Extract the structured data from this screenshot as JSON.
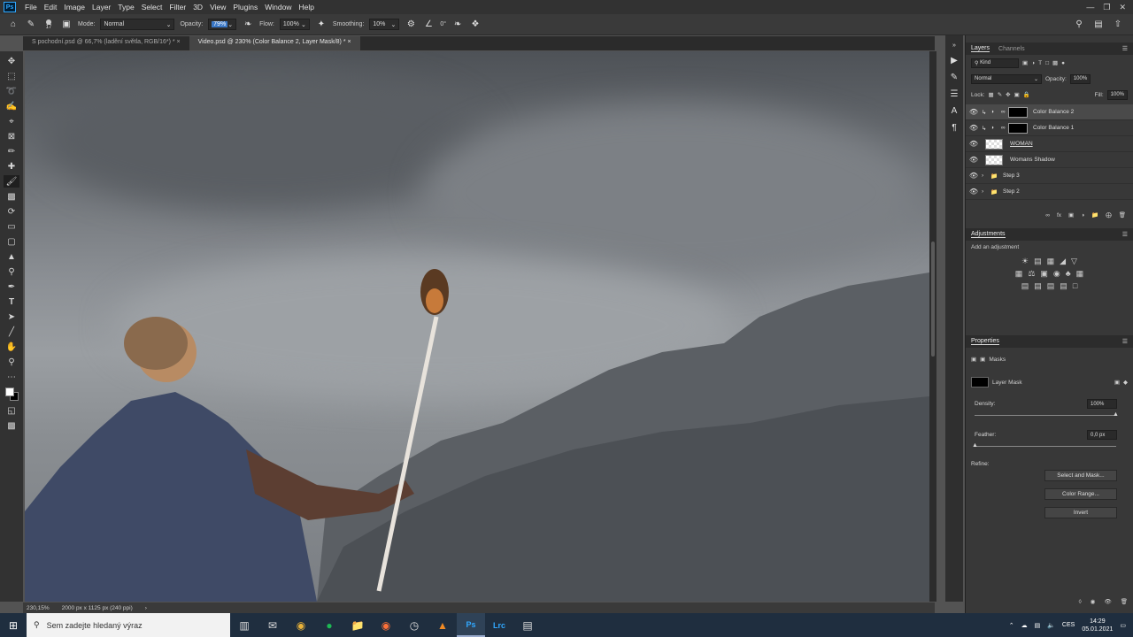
{
  "menubar": {
    "app_icon": "Ps",
    "items": [
      "File",
      "Edit",
      "Image",
      "Layer",
      "Type",
      "Select",
      "Filter",
      "3D",
      "View",
      "Plugins",
      "Window",
      "Help"
    ],
    "window_controls": [
      "minimize-icon",
      "restore-icon",
      "close-icon"
    ]
  },
  "options": {
    "brush_size": "17",
    "mode_label": "Mode:",
    "mode_value": "Normal",
    "opacity_label": "Opacity:",
    "opacity_value": "79%",
    "flow_label": "Flow:",
    "flow_value": "100%",
    "smoothing_label": "Smoothing:",
    "smoothing_value": "10%",
    "angle_value": "0°"
  },
  "tabs": [
    {
      "label": "S pochodní.psd @ 66,7% (ladění světla, RGB/16*) *",
      "active": false
    },
    {
      "label": "Video.psd @ 230% (Color Balance 2, Layer Mask/8) *",
      "active": true
    }
  ],
  "tools": [
    "move-icon",
    "marquee-icon",
    "lasso-icon",
    "quick-select-icon",
    "crop-icon",
    "frame-icon",
    "eyedropper-icon",
    "healing-icon",
    "brush-icon",
    "stamp-icon",
    "history-brush-icon",
    "eraser-icon",
    "gradient-icon",
    "blur-icon",
    "dodge-icon",
    "pen-icon",
    "type-icon",
    "path-select-icon",
    "shape-icon",
    "hand-icon",
    "zoom-icon",
    "more-icon"
  ],
  "status": {
    "zoom": "230,15%",
    "doc_size": "2000 px x 1125 px (240 ppi)"
  },
  "layers_panel": {
    "tab_active": "Layers",
    "tab_other": "Channels",
    "filter_kind": "Kind",
    "blend_mode": "Normal",
    "opacity_label": "Opacity:",
    "opacity_value": "100%",
    "lock_label": "Lock:",
    "fill_label": "Fill:",
    "fill_value": "100%",
    "layers": [
      {
        "name": "Color Balance 2",
        "kind": "adjustment",
        "selected": true
      },
      {
        "name": "Color Balance 1",
        "kind": "adjustment",
        "selected": false
      },
      {
        "name": "WOMAN",
        "kind": "pixel",
        "selected": false
      },
      {
        "name": "Womans Shadow",
        "kind": "pixel",
        "selected": false
      },
      {
        "name": "Step 3",
        "kind": "group",
        "selected": false
      },
      {
        "name": "Step 2",
        "kind": "group",
        "selected": false
      }
    ]
  },
  "adjustments": {
    "title": "Adjustments",
    "subtitle": "Add an adjustment"
  },
  "properties": {
    "title": "Properties",
    "section": "Masks",
    "mask_label": "Layer Mask",
    "density_label": "Density:",
    "density_value": "100%",
    "feather_label": "Feather:",
    "feather_value": "0,0 px",
    "refine_label": "Refine:",
    "btn_select_mask": "Select and Mask...",
    "btn_color_range": "Color Range...",
    "btn_invert": "Invert"
  },
  "taskbar": {
    "search_placeholder": "Sem zadejte hledaný výraz",
    "lang": "CES",
    "time": "14:29",
    "date": "05.01.2021"
  }
}
